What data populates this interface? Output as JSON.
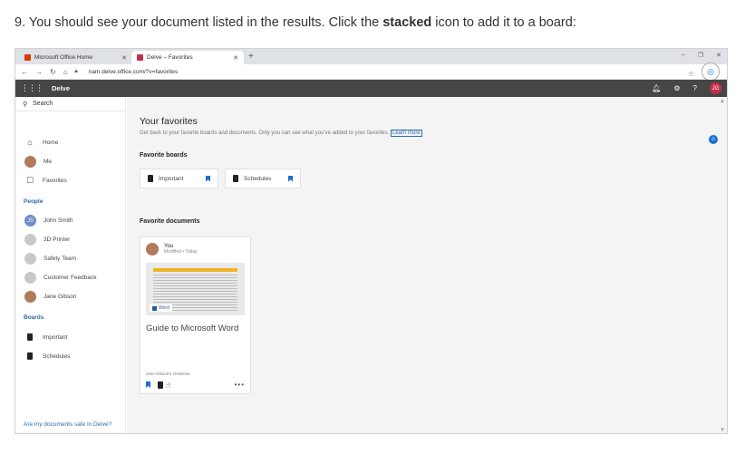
{
  "instruction": {
    "prefix": "9. You should see your document listed in the results. Click the ",
    "bold": "stacked",
    "suffix": " icon to add it to a board:"
  },
  "browser": {
    "tabs": [
      {
        "label": "Microsoft Office Home",
        "favicon_color": "#d83b01"
      },
      {
        "label": "Delve – Favorites",
        "favicon_color": "#c4314b"
      }
    ],
    "url": "nam.delve.office.com/?v=favorites"
  },
  "suite": {
    "app_name": "Delve",
    "user_initials": "JG"
  },
  "sidebar": {
    "search": "Search",
    "nav": [
      {
        "label": "Home",
        "icon": "home-icon"
      },
      {
        "label": "Me",
        "icon": "avatar"
      },
      {
        "label": "Favorites",
        "icon": "favorites-icon"
      }
    ],
    "people_heading": "People",
    "people": [
      {
        "label": "John Smith",
        "initials": "JS"
      },
      {
        "label": "3D Printer"
      },
      {
        "label": "Safety Team"
      },
      {
        "label": "Customer Feedback"
      },
      {
        "label": "Jane Gibson"
      }
    ],
    "boards_heading": "Boards",
    "boards": [
      {
        "label": "Important"
      },
      {
        "label": "Schedules"
      }
    ],
    "safe_link": "Are my documents safe in Delve?"
  },
  "main": {
    "title": "Your favorites",
    "subtitle": "Get back to your favorite boards and documents. Only you can see what you've added to your favorites.",
    "learn_more": "Learn more",
    "favorite_boards_label": "Favorite boards",
    "boards": [
      {
        "label": "Important"
      },
      {
        "label": "Schedules"
      }
    ],
    "favorite_docs_label": "Favorite documents",
    "doc": {
      "author": "You",
      "modified": "Modified • Today",
      "app_tag": "Word",
      "title": "Guide to Microsoft Word",
      "source": "Jane Gibson's OneDrive"
    }
  },
  "colors": {
    "accent": "#1f6fd1",
    "suite_bar": "#464646",
    "avatar_red": "#c4314b"
  }
}
